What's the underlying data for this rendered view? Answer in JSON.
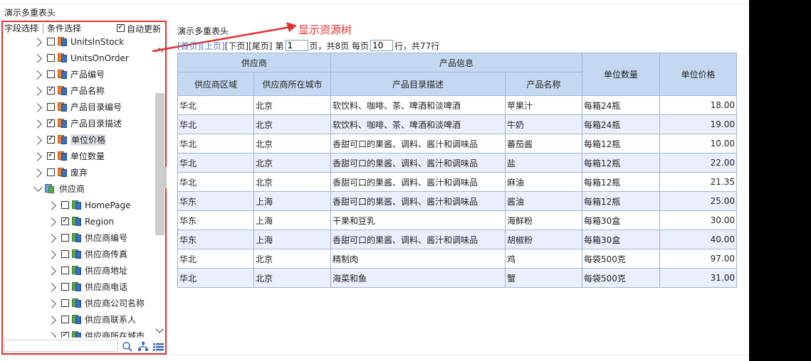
{
  "page_title": "演示多重表头",
  "left_panel": {
    "tabs": [
      "字段选择",
      "条件选择"
    ],
    "auto_update": {
      "label": "自动更新",
      "checked": true
    },
    "tree": [
      {
        "label": "UnitsInStock",
        "checked": false,
        "icon": "field-icon"
      },
      {
        "label": "UnitsOnOrder",
        "checked": false,
        "icon": "field-icon"
      },
      {
        "label": "产品编号",
        "checked": false,
        "icon": "field-icon"
      },
      {
        "label": "产品名称",
        "checked": true,
        "icon": "field-icon"
      },
      {
        "label": "产品目录编号",
        "checked": false,
        "icon": "field-icon"
      },
      {
        "label": "产品目录描述",
        "checked": true,
        "icon": "field-icon"
      },
      {
        "label": "单位价格",
        "checked": true,
        "icon": "field-icon",
        "selected": true
      },
      {
        "label": "单位数量",
        "checked": true,
        "icon": "field-icon"
      },
      {
        "label": "废弃",
        "checked": false,
        "icon": "field-icon"
      },
      {
        "label": "供应商",
        "group": true,
        "icon": "table-icon"
      },
      {
        "label": "HomePage",
        "checked": false,
        "icon": "field-icon-green",
        "child": true
      },
      {
        "label": "Region",
        "checked": true,
        "icon": "field-icon-green",
        "child": true
      },
      {
        "label": "供应商编号",
        "checked": false,
        "icon": "field-icon-green",
        "child": true
      },
      {
        "label": "供应商传真",
        "checked": false,
        "icon": "field-icon-green",
        "child": true
      },
      {
        "label": "供应商地址",
        "checked": false,
        "icon": "field-icon-green",
        "child": true
      },
      {
        "label": "供应商电话",
        "checked": false,
        "icon": "field-icon-green",
        "child": true
      },
      {
        "label": "供应商公司名称",
        "checked": false,
        "icon": "field-icon-green",
        "child": true
      },
      {
        "label": "供应商联系人",
        "checked": false,
        "icon": "field-icon-green",
        "child": true
      },
      {
        "label": "供应商所在城市",
        "checked": true,
        "icon": "field-icon-green",
        "child": true
      }
    ],
    "search_placeholder": ""
  },
  "annotation": {
    "text": "显示资源树",
    "color": "#e82f2f"
  },
  "report": {
    "title": "演示多重表头",
    "pager": {
      "first": "[首页]",
      "prev": "[上页]",
      "next": "[下页]",
      "last": "[尾页]",
      "page_prefix": "第",
      "page_value": "1",
      "page_suffix": "页，共8页 每页",
      "per_page_value": "10",
      "per_page_suffix": "行，共77行"
    },
    "header_groups": [
      "供应商",
      "产品信息",
      "单位数量",
      "单位价格"
    ],
    "columns": [
      "供应商区域",
      "供应商所在城市",
      "产品目录描述",
      "产品名称"
    ],
    "rows": [
      [
        "华北",
        "北京",
        "软饮料、咖啡、茶、啤酒和淡啤酒",
        "苹果汁",
        "每箱24瓶",
        "18.00"
      ],
      [
        "华北",
        "北京",
        "软饮料、咖啡、茶、啤酒和淡啤酒",
        "牛奶",
        "每箱24瓶",
        "19.00"
      ],
      [
        "华北",
        "北京",
        "香甜可口的果酱、调料、酱汁和调味品",
        "蕃茄酱",
        "每箱12瓶",
        "10.00"
      ],
      [
        "华北",
        "北京",
        "香甜可口的果酱、调料、酱汁和调味品",
        "盐",
        "每箱12瓶",
        "22.00"
      ],
      [
        "华北",
        "北京",
        "香甜可口的果酱、调料、酱汁和调味品",
        "麻油",
        "每箱12瓶",
        "21.35"
      ],
      [
        "华东",
        "上海",
        "香甜可口的果酱、调料、酱汁和调味品",
        "酱油",
        "每箱12瓶",
        "25.00"
      ],
      [
        "华东",
        "上海",
        "干果和豆乳",
        "海鲜粉",
        "每箱30盒",
        "30.00"
      ],
      [
        "华东",
        "上海",
        "香甜可口的果酱、调料、酱汁和调味品",
        "胡椒粉",
        "每箱30盒",
        "40.00"
      ],
      [
        "华北",
        "北京",
        "精制肉",
        "鸡",
        "每袋500克",
        "97.00"
      ],
      [
        "华北",
        "北京",
        "海菜和鱼",
        "蟹",
        "每袋500克",
        "31.00"
      ]
    ]
  },
  "colors": {
    "header_bg": "#c4d9f1",
    "row_alt_bg": "#ebeefc",
    "highlight_red": "#e82f2f",
    "link_blue": "#5b74b8"
  }
}
